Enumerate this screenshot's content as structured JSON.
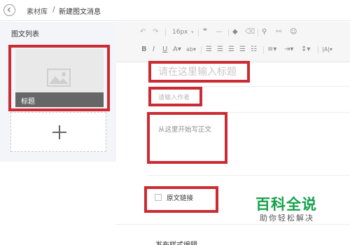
{
  "breadcrumb": {
    "parent": "素材库",
    "separator": "/",
    "current": "新建图文消息"
  },
  "sidebar": {
    "title": "图文列表",
    "article_title": "标题",
    "add_icon": "plus-icon"
  },
  "toolbar": {
    "font_size": "16px",
    "row1_icons": [
      "undo-icon",
      "redo-icon",
      "font-size-select",
      "quote-icon",
      "horizontal-rule-icon",
      "tag-icon",
      "eraser-icon",
      "link-icon",
      "unlink-icon",
      "emoji-icon"
    ],
    "row2_icons": [
      "bold-icon",
      "italic-icon",
      "underline-icon",
      "font-color-icon",
      "background-color-icon",
      "align-left-icon",
      "align-center-icon",
      "align-right-icon",
      "justify-icon",
      "list-icon",
      "ordered-list-icon",
      "indent-icon",
      "line-height-icon",
      "letter-spacing-icon"
    ]
  },
  "editor": {
    "title_placeholder": "请在这里输入标题",
    "author_placeholder": "请输入作者",
    "body_placeholder": "从这里开始写正文",
    "original_link_label": "原文链接",
    "style_editor_label": "发布样式编辑"
  },
  "watermark": {
    "main": "百科全说",
    "sub": "助你轻松解决"
  },
  "colors": {
    "highlight": "#cc2b33",
    "watermark_green": "#16a04a",
    "sidebar_bg": "#f4f5f9"
  }
}
